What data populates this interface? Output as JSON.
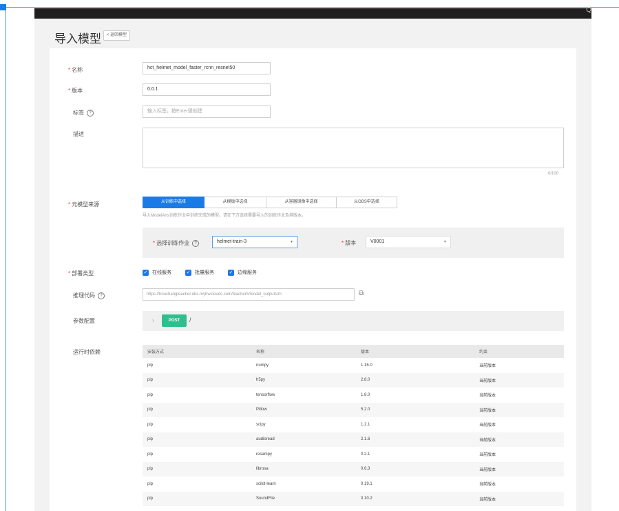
{
  "header": {
    "title": "导入模型",
    "back_label": "< 返回模型"
  },
  "topbar": {
    "corner_glyph": "Q"
  },
  "form": {
    "name": {
      "label": "名称",
      "value": "hct_helmet_model_faster_rcnn_resnet50"
    },
    "version": {
      "label": "版本",
      "value": "0.0.1"
    },
    "tags": {
      "label": "标签",
      "placeholder": "输入标签，按Enter键创建"
    },
    "description": {
      "label": "描述",
      "counter": "0/100"
    },
    "source": {
      "label": "元模型来源",
      "tabs": [
        "从训练中选择",
        "从模板中选择",
        "从容器镜像中选择",
        "从OBS中选择"
      ],
      "hint": "导入ModelArts训练作业中训练完成的模型。请在下方选择需要导入的训练作业及其版本。",
      "job_label": "选择训练作业",
      "job_value": "helmet-train-3",
      "job_version_label": "版本",
      "job_version_value": "V0001"
    },
    "deploy_type": {
      "label": "部署类型",
      "options": [
        "在线服务",
        "批量服务",
        "边缘服务"
      ]
    },
    "inference_code": {
      "label": "推理代码",
      "value": "https://houchangteacher.obs.myhwclouds.com/teacher5/model_outputs/m"
    },
    "api": {
      "label": "参数配置",
      "method": "POST",
      "path": "/"
    },
    "runtime_deps": {
      "label": "运行时依赖",
      "columns": [
        "安装方式",
        "名称",
        "版本",
        "约束"
      ],
      "rows": [
        [
          "pip",
          "numpy",
          "1.15.0",
          "当前版本"
        ],
        [
          "pip",
          "h5py",
          "2.8.0",
          "当前版本"
        ],
        [
          "pip",
          "tensorflow",
          "1.8.0",
          "当前版本"
        ],
        [
          "pip",
          "Pillow",
          "5.2.0",
          "当前版本"
        ],
        [
          "pip",
          "scipy",
          "1.2.1",
          "当前版本"
        ],
        [
          "pip",
          "audioread",
          "2.1.6",
          "当前版本"
        ],
        [
          "pip",
          "resampy",
          "0.2.1",
          "当前版本"
        ],
        [
          "pip",
          "librosa",
          "0.6.3",
          "当前版本"
        ],
        [
          "pip",
          "scikit-learn",
          "0.19.1",
          "当前版本"
        ],
        [
          "pip",
          "SoundFile",
          "0.10.2",
          "当前版本"
        ]
      ]
    }
  },
  "colors": {
    "primary": "#1a7ae6",
    "post_badge": "#2fbf8f",
    "required": "#e4393c"
  }
}
